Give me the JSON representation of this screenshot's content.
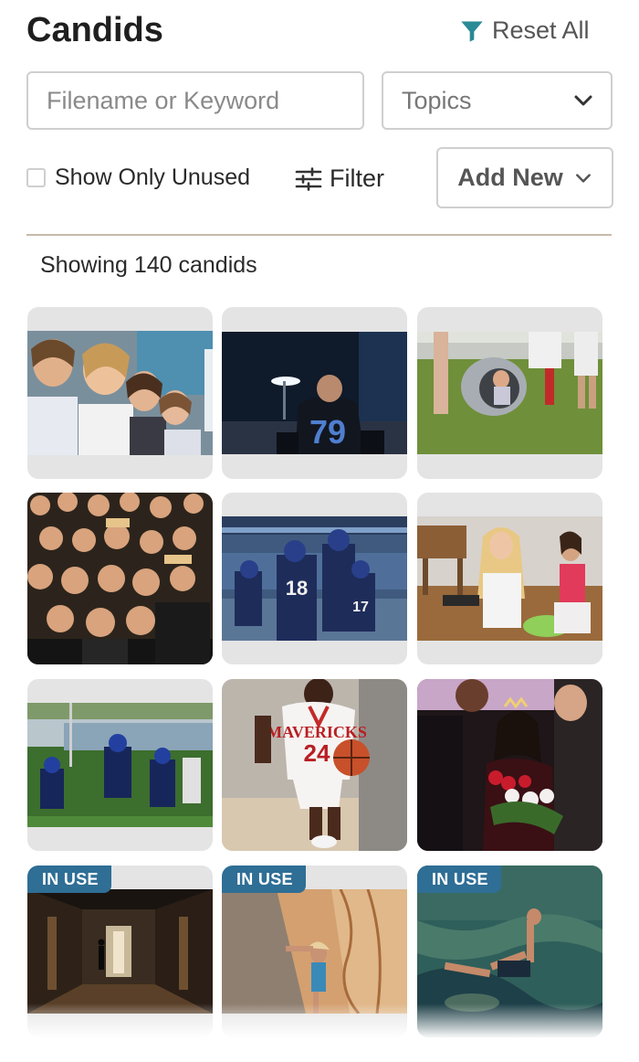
{
  "header": {
    "title": "Candids",
    "reset_label": "Reset All",
    "reset_icon": "filter-funnel-icon"
  },
  "search": {
    "placeholder": "Filename or Keyword",
    "value": ""
  },
  "topics": {
    "selected": "Topics",
    "icon": "chevron-down-icon"
  },
  "unused": {
    "label": "Show Only Unused",
    "checked": false
  },
  "filter": {
    "label": "Filter",
    "icon": "sliders-icon"
  },
  "add_new": {
    "label": "Add New",
    "icon": "chevron-down-icon"
  },
  "results": {
    "count_text": "Showing 140 candids"
  },
  "colors": {
    "accent": "#2a8a96",
    "badge": "#2f6e95",
    "card_bg": "#e4e4e4",
    "divider": "#c9b9aa"
  },
  "photos": [
    {
      "id": "cheering-fans",
      "in_use": false
    },
    {
      "id": "football-player-79",
      "in_use": false
    },
    {
      "id": "kids-playground-tunnel",
      "in_use": false
    },
    {
      "id": "student-crowd-cheering",
      "in_use": false
    },
    {
      "id": "football-players-celebrating",
      "in_use": false
    },
    {
      "id": "students-on-floor",
      "in_use": false
    },
    {
      "id": "football-game-play",
      "in_use": false
    },
    {
      "id": "basketball-player-24",
      "in_use": false
    },
    {
      "id": "homecoming-queen",
      "in_use": false
    },
    {
      "id": "school-hallway",
      "in_use": true,
      "badge": "IN USE"
    },
    {
      "id": "rock-climber",
      "in_use": true,
      "badge": "IN USE"
    },
    {
      "id": "cliff-diver-water",
      "in_use": true,
      "badge": "IN USE"
    }
  ]
}
